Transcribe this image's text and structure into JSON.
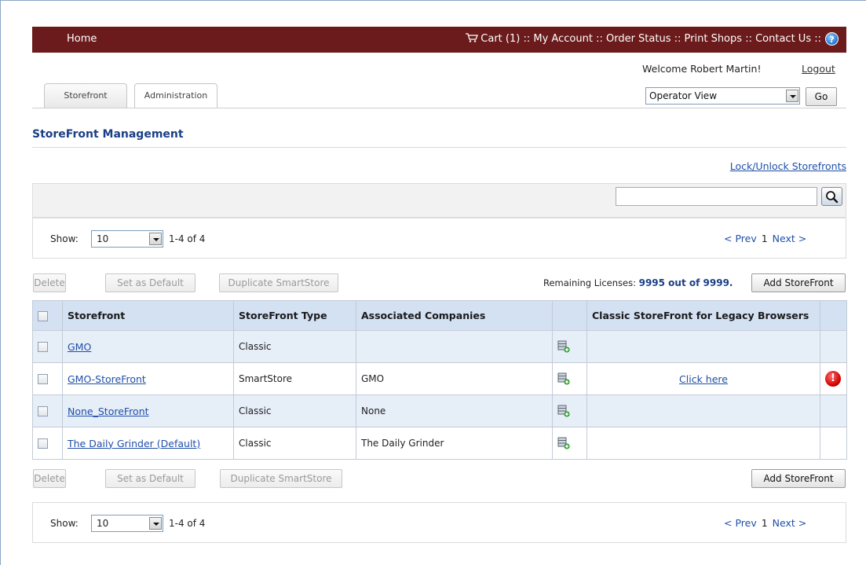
{
  "nav": {
    "home": "Home",
    "cart": "Cart (1)",
    "my_account": "My Account",
    "order_status": "Order Status",
    "print_shops": "Print Shops",
    "contact_us": "Contact Us",
    "separator": "::",
    "help": "?"
  },
  "user": {
    "welcome": "Welcome Robert Martin!",
    "logout": "Logout"
  },
  "tabs": [
    {
      "label": "Storefront",
      "active": false
    },
    {
      "label": "Administration",
      "active": true
    }
  ],
  "view_selector": {
    "value": "Operator View",
    "go": "Go"
  },
  "page": {
    "title": "StoreFront Management",
    "lock_link": "Lock/Unlock Storefronts"
  },
  "pager": {
    "show_label": "Show:",
    "page_size": "10",
    "range": "1-4 of 4",
    "prev": "< Prev",
    "current": "1",
    "next": "Next >"
  },
  "actions": {
    "delete": "Delete",
    "set_default": "Set as Default",
    "duplicate": "Duplicate SmartStore",
    "add": "Add StoreFront"
  },
  "licenses": {
    "label": "Remaining Licenses:",
    "value": "9995 out of 9999."
  },
  "table": {
    "headers": [
      "Storefront",
      "StoreFront Type",
      "Associated Companies",
      "",
      "Classic StoreFront for Legacy Browsers",
      ""
    ],
    "rows": [
      {
        "name": "GMO",
        "type": "Classic",
        "companies": "",
        "classic": "",
        "warning": false
      },
      {
        "name": "GMO-StoreFront",
        "type": "SmartStore",
        "companies": "GMO",
        "classic": "Click here",
        "warning": true
      },
      {
        "name": "None_StoreFront",
        "type": "Classic",
        "companies": "None",
        "classic": "",
        "warning": false
      },
      {
        "name": "The Daily Grinder (Default)",
        "type": "Classic",
        "companies": "The Daily Grinder",
        "classic": "",
        "warning": false
      }
    ]
  },
  "colors": {
    "topbar": "#6b1b1b",
    "title": "#1a3f86",
    "link": "#1f4fa8",
    "header_row": "#d3e1f3",
    "alt_row": "#e6eef8"
  },
  "icons": [
    "cart-icon",
    "help-icon",
    "search-icon",
    "database-add-icon",
    "warning-icon",
    "chevron-down-icon"
  ]
}
